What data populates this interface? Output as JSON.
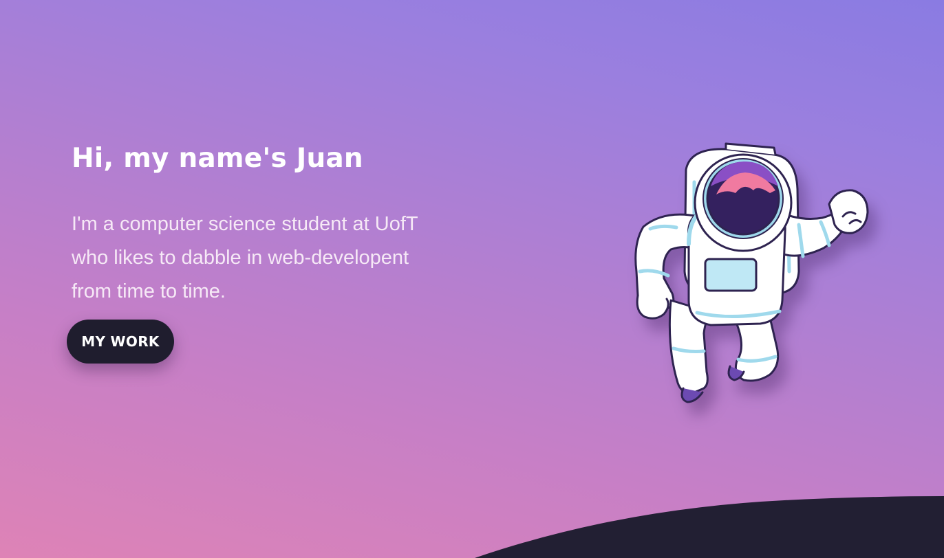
{
  "hero": {
    "title": "Hi, my name's Juan",
    "description_lines": [
      "I'm a computer science student at UofT",
      "who likes to dabble in web-developent",
      "from time to time."
    ],
    "cta_label": "MY WORK"
  },
  "colors": {
    "gradient_start": "#de83b6",
    "gradient_end": "#8a7be2",
    "button_bg": "#1f1d2e",
    "ground": "#221f33",
    "text": "#ffffff"
  },
  "icons": {
    "illustration": "astronaut-icon"
  }
}
